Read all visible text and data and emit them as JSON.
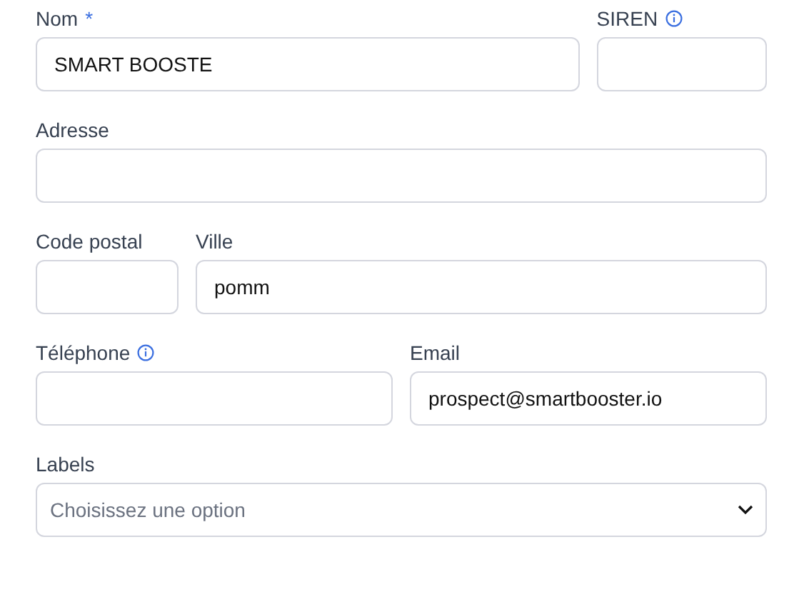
{
  "rows": [
    {
      "fields": [
        {
          "kind": "text",
          "label": "Nom",
          "required_mark": "*",
          "info": false,
          "value": "SMART BOOSTE"
        },
        {
          "kind": "text",
          "label": "SIREN",
          "info": true
        }
      ]
    },
    {
      "fields": [
        {
          "kind": "text",
          "label": "Adresse",
          "info": false
        }
      ]
    },
    {
      "fields": [
        {
          "kind": "text",
          "label": "Code postal",
          "info": false
        },
        {
          "kind": "text",
          "label": "Ville",
          "info": false,
          "value": "pomm"
        }
      ]
    },
    {
      "fields": [
        {
          "kind": "text",
          "label": "Téléphone",
          "info": true
        },
        {
          "kind": "text",
          "label": "Email",
          "info": false,
          "value": "prospect@smartbooster.io"
        }
      ]
    },
    {
      "fields": [
        {
          "kind": "select",
          "label": "Labels",
          "info": false,
          "placeholder": "Choisissez une option"
        }
      ]
    }
  ]
}
